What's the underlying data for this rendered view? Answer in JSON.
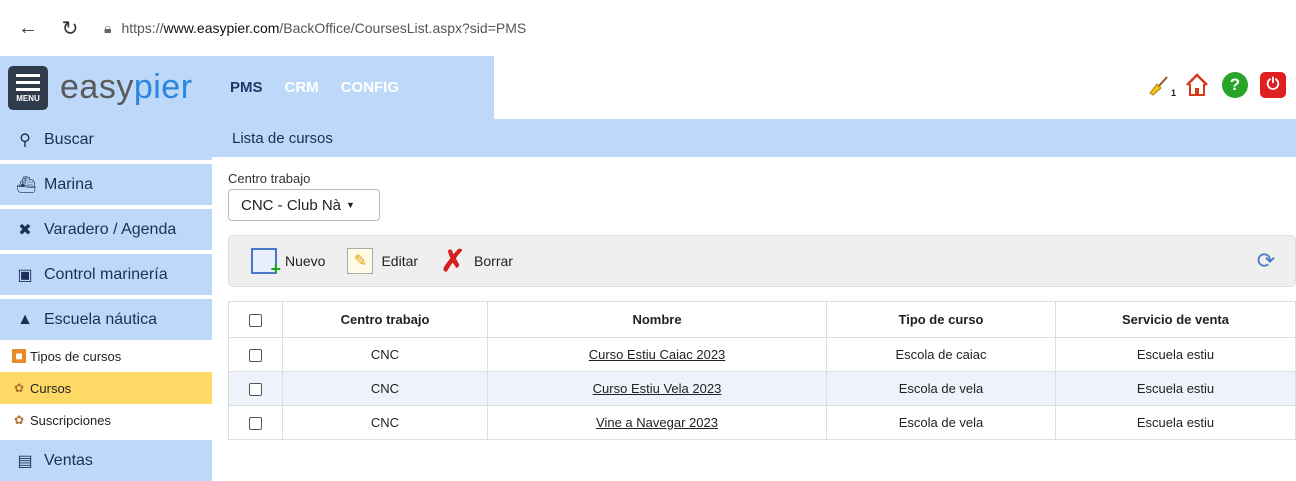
{
  "browser": {
    "url_prefix": "https://",
    "url_host": "www.easypier.com",
    "url_path": "/BackOffice/CoursesList.aspx?sid=PMS"
  },
  "header": {
    "menu_label": "MENU",
    "logo_easy": "easy",
    "logo_pier": "pier",
    "nav": [
      "PMS",
      "CRM",
      "CONFIG"
    ],
    "badge_count": "1",
    "accent": "#bdd8f8"
  },
  "sidebar": {
    "items": [
      {
        "label": "Buscar",
        "icon": "search-icon"
      },
      {
        "label": "Marina",
        "icon": "ship-icon"
      },
      {
        "label": "Varadero / Agenda",
        "icon": "tools-icon"
      },
      {
        "label": "Control marinería",
        "icon": "clipboard-icon"
      },
      {
        "label": "Escuela náutica",
        "icon": "graduation-cap-icon"
      }
    ],
    "subitems": [
      {
        "label": "Tipos de cursos",
        "icon": "book-icon"
      },
      {
        "label": "Cursos",
        "icon": "group-icon",
        "active": true
      },
      {
        "label": "Suscripciones",
        "icon": "group-icon"
      }
    ],
    "last_item": {
      "label": "Ventas",
      "icon": "receipt-icon"
    }
  },
  "main": {
    "title": "Lista de cursos",
    "centro_label": "Centro trabajo",
    "centro_value": "CNC - Club Nà",
    "toolbar": {
      "new": "Nuevo",
      "edit": "Editar",
      "delete": "Borrar"
    },
    "table": {
      "headers": [
        "Centro trabajo",
        "Nombre",
        "Tipo de curso",
        "Servicio de venta"
      ],
      "rows": [
        {
          "centro": "CNC",
          "nombre": "Curso Estiu Caiac 2023",
          "tipo": "Escola de caiac",
          "servicio": "Escuela estiu"
        },
        {
          "centro": "CNC",
          "nombre": "Curso Estiu Vela 2023",
          "tipo": "Escola de vela",
          "servicio": "Escuela estiu"
        },
        {
          "centro": "CNC",
          "nombre": "Vine a Navegar 2023",
          "tipo": "Escola de vela",
          "servicio": "Escuela estiu"
        }
      ]
    }
  }
}
